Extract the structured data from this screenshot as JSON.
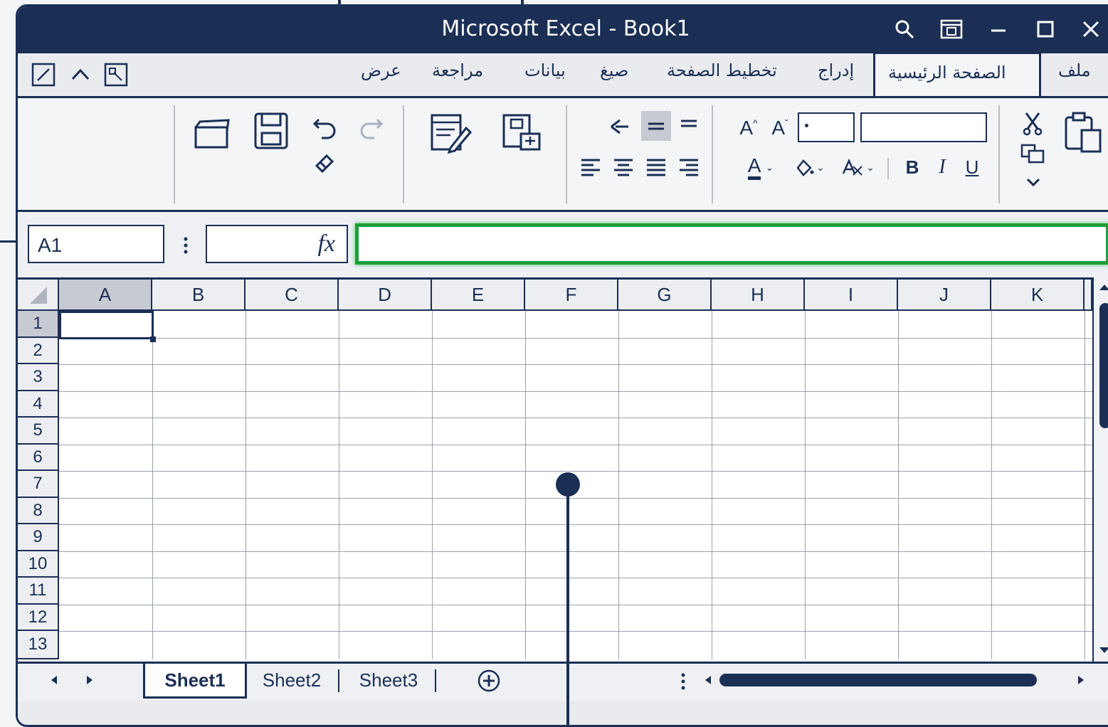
{
  "window": {
    "title": "Microsoft Excel - Book1"
  },
  "title_controls": [
    "search-icon",
    "display-options-icon",
    "minimize-icon",
    "maximize-icon",
    "close-icon"
  ],
  "ribbon_tabs": [
    {
      "label": "ملف"
    },
    {
      "label": "الصفحة الرئيسية",
      "active": true
    },
    {
      "label": "إدراج"
    },
    {
      "label": "تخطيط الصفحة"
    },
    {
      "label": "صيغ"
    },
    {
      "label": "بيانات"
    },
    {
      "label": "مراجعة"
    },
    {
      "label": "عرض"
    }
  ],
  "ribbon": {
    "font_size_value": "",
    "font_name_value": "",
    "bold": "B",
    "italic": "I",
    "underline": "U",
    "font_color": "A",
    "grow_font": "A",
    "shrink_font": "A"
  },
  "formula_bar": {
    "name_box": "A1",
    "fx_label": "fx",
    "formula_value": ""
  },
  "grid": {
    "columns": [
      "A",
      "B",
      "C",
      "D",
      "E",
      "F",
      "G",
      "H",
      "I",
      "J",
      "K"
    ],
    "rows": [
      "1",
      "2",
      "3",
      "4",
      "5",
      "6",
      "7",
      "8",
      "9",
      "10",
      "11",
      "12",
      "13"
    ],
    "selected_cell": "A1"
  },
  "sheets": [
    {
      "label": "Sheet1",
      "active": true
    },
    {
      "label": "Sheet2"
    },
    {
      "label": "Sheet3"
    }
  ],
  "colors": {
    "navy": "#1b2f55",
    "formula_highlight": "#1e9e3b"
  }
}
